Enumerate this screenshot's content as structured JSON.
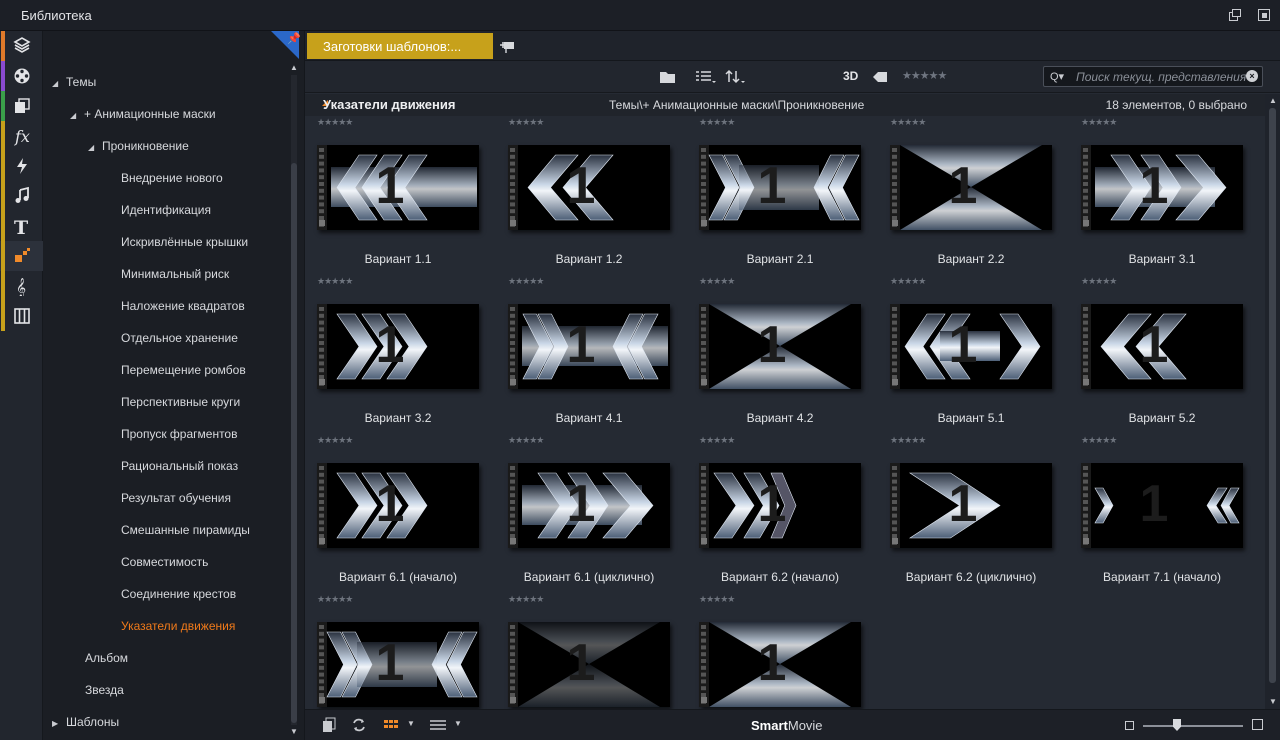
{
  "window": {
    "title": "Библиотека"
  },
  "rail": {
    "items": [
      {
        "icon": "project-bin-icon",
        "color": "#e07a2a"
      },
      {
        "icon": "film-reel-icon",
        "color": "#8a4bd0"
      },
      {
        "icon": "pages-icon",
        "color": "#3aa04a"
      },
      {
        "icon": "fx-icon",
        "color": "#c7a11b"
      },
      {
        "icon": "lightning-icon",
        "color": "#c7a11b"
      },
      {
        "icon": "music-note-icon",
        "color": "#c7a11b"
      },
      {
        "icon": "text-icon",
        "color": "#c7a11b"
      },
      {
        "icon": "themes-icon",
        "color": "#c7a11b"
      },
      {
        "icon": "treble-clef-icon",
        "color": "#c7a11b"
      },
      {
        "icon": "piano-icon",
        "color": "#c7a11b"
      }
    ]
  },
  "tree": {
    "root": "Темы",
    "masks": "+ Анимационные маски",
    "group": "Проникновение",
    "items": [
      "Внедрение нового",
      "Идентификация",
      "Искривлённые крышки",
      "Минимальный риск",
      "Наложение квадратов",
      "Отдельное хранение",
      "Перемещение ромбов",
      "Перспективные круги",
      "Пропуск фрагментов",
      "Рациональный показ",
      "Результат обучения",
      "Смешанные пирамиды",
      "Совместимость",
      "Соединение крестов",
      "Указатели движения"
    ],
    "siblings": [
      "Альбом",
      "Звезда"
    ],
    "templates": "Шаблоны"
  },
  "tab": {
    "label": "Заготовки шаблонов:..."
  },
  "toolbar": {
    "mode_3d": "3D",
    "rating_stars": "★★★★★",
    "search_placeholder": "Поиск текущ. представления",
    "search_prefix": "Q▾"
  },
  "crumb": {
    "title": "Указатели движения",
    "path": "Темы\\+ Анимационные маски\\Проникновение",
    "count": "18 элементов, 0 выбрано"
  },
  "cards": [
    {
      "name": "Вариант 1.1",
      "stars": "★★★★★"
    },
    {
      "name": "Вариант 1.2",
      "stars": "★★★★★"
    },
    {
      "name": "Вариант 2.1",
      "stars": "★★★★★"
    },
    {
      "name": "Вариант 2.2",
      "stars": "★★★★★"
    },
    {
      "name": "Вариант 3.1",
      "stars": "★★★★★"
    },
    {
      "name": "Вариант 3.2",
      "stars": "★★★★★"
    },
    {
      "name": "Вариант 4.1",
      "stars": "★★★★★"
    },
    {
      "name": "Вариант 4.2",
      "stars": "★★★★★"
    },
    {
      "name": "Вариант 5.1",
      "stars": "★★★★★"
    },
    {
      "name": "Вариант 5.2",
      "stars": "★★★★★"
    },
    {
      "name": "Вариант 6.1 (начало)",
      "stars": "★★★★★"
    },
    {
      "name": "Вариант 6.1 (циклично)",
      "stars": "★★★★★"
    },
    {
      "name": "Вариант 6.2 (начало)",
      "stars": "★★★★★"
    },
    {
      "name": "Вариант 6.2 (циклично)",
      "stars": "★★★★★"
    },
    {
      "name": "Вариант 7.1 (начало)",
      "stars": "★★★★★"
    },
    {
      "name": "",
      "stars": "★★★★★"
    },
    {
      "name": "",
      "stars": "★★★★★"
    },
    {
      "name": "",
      "stars": "★★★★★"
    }
  ],
  "thumb_digit": "1",
  "status": {
    "brand_bold": "Smart",
    "brand_rest": "Movie"
  },
  "colors": {
    "accent": "#f07a1a",
    "tab": "#c7a11b",
    "pin": "#2b68c9"
  }
}
